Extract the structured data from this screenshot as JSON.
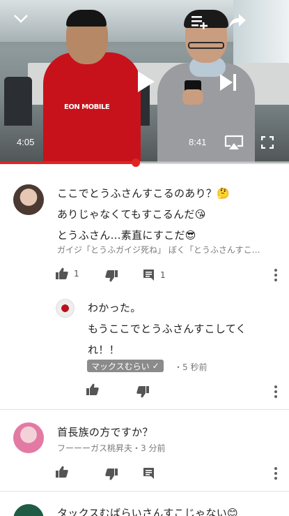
{
  "player": {
    "current_time": "4:05",
    "duration": "8:41",
    "progress_fraction": 0.47,
    "accent_color": "#e02424",
    "shirt_text": "EON MOBILE"
  },
  "comments": [
    {
      "lines": [
        "ここでとうふさんすこるのあり？🤔",
        "ありじゃなくてもすこるんだ😘",
        "とうふさん…素直にすこだ😎"
      ],
      "meta": "ガイジ「とうふガイジ死ね」 ぼく「とうふさんすこ…",
      "like_count": "1",
      "reply_count": "1",
      "reply": {
        "lines": [
          "わかった。",
          "もうここでとうふさんすこしてく",
          "れ！！"
        ],
        "author_badge": "マックスむらい",
        "badge_check": "✓",
        "time": "・5 秒前"
      }
    },
    {
      "lines": [
        "首長族の方ですか？"
      ],
      "meta": "フーーーガス桃昇夫・3 分前"
    },
    {
      "lines": [
        "タックスむばらいさんすこじゃない😊"
      ]
    }
  ]
}
